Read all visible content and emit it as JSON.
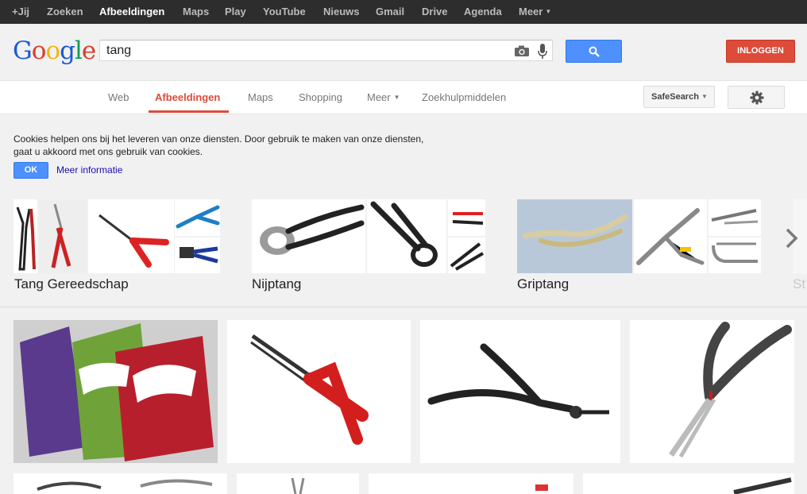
{
  "topnav": {
    "items": [
      "+Jij",
      "Zoeken",
      "Afbeeldingen",
      "Maps",
      "Play",
      "YouTube",
      "Nieuws",
      "Gmail",
      "Drive",
      "Agenda",
      "Meer"
    ],
    "active": "Afbeeldingen"
  },
  "header": {
    "logo": [
      "G",
      "o",
      "o",
      "g",
      "l",
      "e"
    ],
    "query": "tang",
    "login_label": "INLOGGEN"
  },
  "tabs": {
    "items": [
      "Web",
      "Afbeeldingen",
      "Maps",
      "Shopping",
      "Meer",
      "Zoekhulpmiddelen"
    ],
    "active": "Afbeeldingen",
    "safesearch_label": "SafeSearch"
  },
  "cookie": {
    "text": "Cookies helpen ons bij het leveren van onze diensten. Door gebruik te maken van onze diensten, gaat u akkoord met ons gebruik van cookies.",
    "ok_label": "OK",
    "more_label": "Meer informatie"
  },
  "related": [
    {
      "name": "Tang Gereedschap"
    },
    {
      "name": "Nijptang"
    },
    {
      "name": "Griptang"
    },
    {
      "name": "St"
    }
  ],
  "icons": {
    "camera": "camera-icon",
    "mic": "microphone-icon",
    "search": "search-icon",
    "gear": "gear-icon",
    "next": "chevron-right-icon"
  },
  "colors": {
    "accent_red": "#dd4b39",
    "accent_blue": "#4d90fe",
    "topbar": "#2d2d2d"
  }
}
